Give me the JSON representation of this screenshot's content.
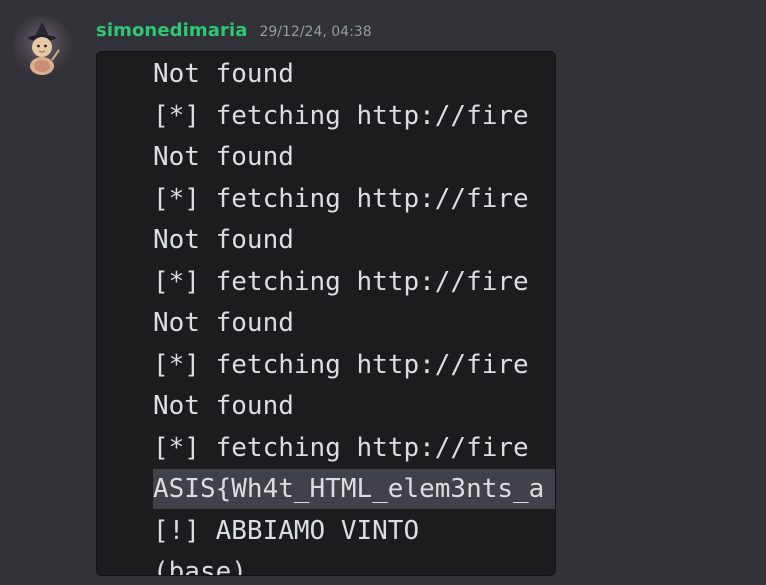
{
  "message": {
    "author": "simonedimaria",
    "timestamp": "29/12/24, 04:38",
    "code_lines": [
      "Not found",
      "[*] fetching http://fire",
      "Not found",
      "[*] fetching http://fire",
      "Not found",
      "[*] fetching http://fire",
      "Not found",
      "[*] fetching http://fire",
      "Not found",
      "[*] fetching http://fire",
      "ASIS{Wh4t_HTML_elem3nts_a",
      "[!] ABBIAMO VINTO",
      "(base)"
    ],
    "highlighted_line_index": 10
  },
  "colors": {
    "background": "#313338",
    "username": "#2fc774",
    "timestamp": "#949ba4",
    "code_background": "#1c1c1f",
    "code_text": "#dbdee1",
    "selection": "#414249"
  }
}
